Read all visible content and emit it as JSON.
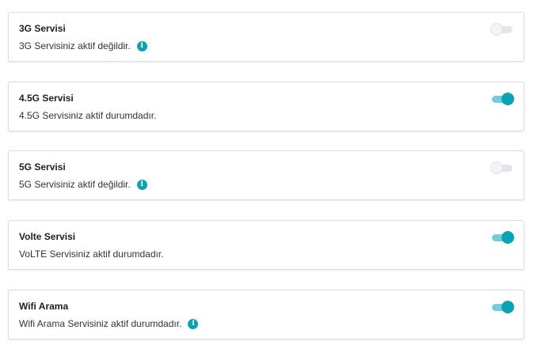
{
  "colors": {
    "accent": "#0ba3b3",
    "accent_light": "#74ced7"
  },
  "services": [
    {
      "title": "3G Servisi",
      "description": "3G Servisiniz aktif değildir.",
      "enabled": false,
      "has_info": true,
      "info_icon": "info-icon",
      "info_glyph": "i"
    },
    {
      "title": "4.5G Servisi",
      "description": "4.5G Servisiniz aktif durumdadır.",
      "enabled": true,
      "has_info": false
    },
    {
      "title": "5G Servisi",
      "description": "5G Servisiniz aktif değildir.",
      "enabled": false,
      "has_info": true,
      "info_icon": "info-icon",
      "info_glyph": "i"
    },
    {
      "title": "Volte Servisi",
      "description": "VoLTE Servisiniz aktif durumdadır.",
      "enabled": true,
      "has_info": false
    },
    {
      "title": "Wifi Arama",
      "description": "Wifi Arama Servisiniz aktif durumdadır.",
      "enabled": true,
      "has_info": true,
      "info_icon": "info-icon",
      "info_glyph": "i"
    }
  ]
}
